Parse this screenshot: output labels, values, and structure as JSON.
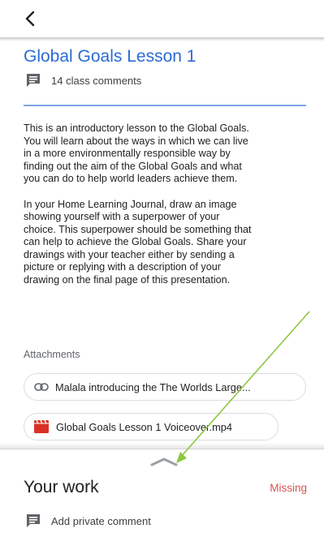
{
  "header": {
    "back_icon": "chevron-left-icon"
  },
  "post": {
    "title": "Global Goals Lesson 1",
    "comments_icon": "comment-icon",
    "comments_label": "14 class comments",
    "description": [
      "This is an introductory lesson to the Global Goals.\nYou will learn about the ways in which we can live\nin a more environmentally responsible way by\nfinding out the aim of the Global Goals and what\nyou can do to help world leaders achieve them.",
      "In your Home Learning Journal, draw an image\nshowing yourself with a superpower of your\nchoice. This superpower should be something that\ncan help to achieve the Global Goals. Share your\ndrawings with your teacher either by sending  a\npicture or replying with a description of your\ndrawing on the final page of this presentation."
    ]
  },
  "attachments": {
    "label": "Attachments",
    "items": [
      {
        "icon": "link-icon",
        "name": "Malala introducing the The Worlds Large..."
      },
      {
        "icon": "video-file-icon",
        "name": "Global Goals Lesson 1 Voiceover.mp4"
      }
    ]
  },
  "your_work": {
    "title": "Your work",
    "status": "Missing",
    "private_comment_icon": "comment-icon",
    "private_comment_label": "Add private comment"
  },
  "colors": {
    "title_blue": "#2a6bd4",
    "divider_blue": "#7fa3e6",
    "missing_red": "#d9534f",
    "video_icon_red": "#d93025",
    "annotation_arrow": "#8cc63f"
  }
}
